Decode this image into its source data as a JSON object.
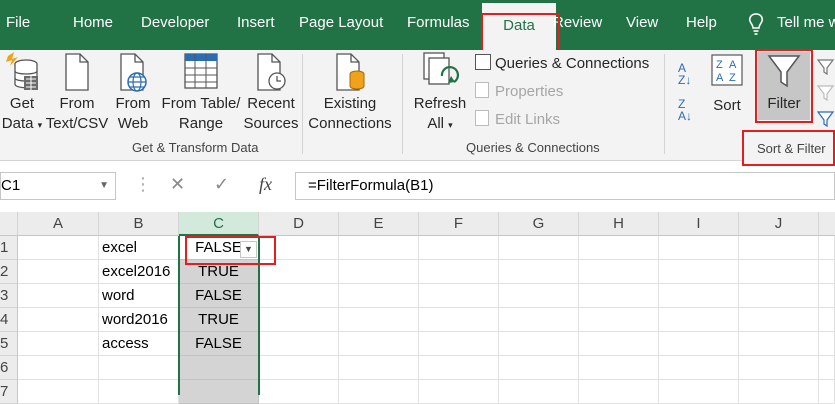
{
  "tabs": [
    "File",
    "Home",
    "Developer",
    "Insert",
    "Page Layout",
    "Formulas",
    "Data",
    "Review",
    "View",
    "Help"
  ],
  "active_tab": "Data",
  "tell_me": "Tell me w",
  "ribbon": {
    "get_data": {
      "line1": "Get",
      "line2": "Data"
    },
    "from_text_csv": {
      "line1": "From",
      "line2": "Text/CSV"
    },
    "from_web": {
      "line1": "From",
      "line2": "Web"
    },
    "from_table_range": {
      "line1": "From Table/",
      "line2": "Range"
    },
    "recent_sources": {
      "line1": "Recent",
      "line2": "Sources"
    },
    "existing_connections": {
      "line1": "Existing",
      "line2": "Connections"
    },
    "get_transform_label": "Get & Transform Data",
    "refresh_all": {
      "line1": "Refresh",
      "line2": "All"
    },
    "queries_connections": "Queries & Connections",
    "properties": "Properties",
    "edit_links": "Edit Links",
    "queries_group_label": "Queries & Connections",
    "sort": "Sort",
    "filter": "Filter",
    "sort_filter_label": "Sort & Filter"
  },
  "formula_bar": {
    "name_box": "C1",
    "fx": "fx",
    "formula": "=FilterFormula(B1)"
  },
  "grid": {
    "columns": [
      "A",
      "B",
      "C",
      "D",
      "E",
      "F",
      "G",
      "H",
      "I",
      "J"
    ],
    "rows": [
      "1",
      "2",
      "3",
      "4",
      "5",
      "6",
      "7"
    ],
    "col_b": [
      "excel",
      "excel2016",
      "word",
      "word2016",
      "access",
      "",
      ""
    ],
    "col_c": [
      "FALSE",
      "TRUE",
      "FALSE",
      "TRUE",
      "FALSE",
      "",
      ""
    ]
  },
  "colors": {
    "accent": "#217346",
    "highlight": "#e02020"
  }
}
